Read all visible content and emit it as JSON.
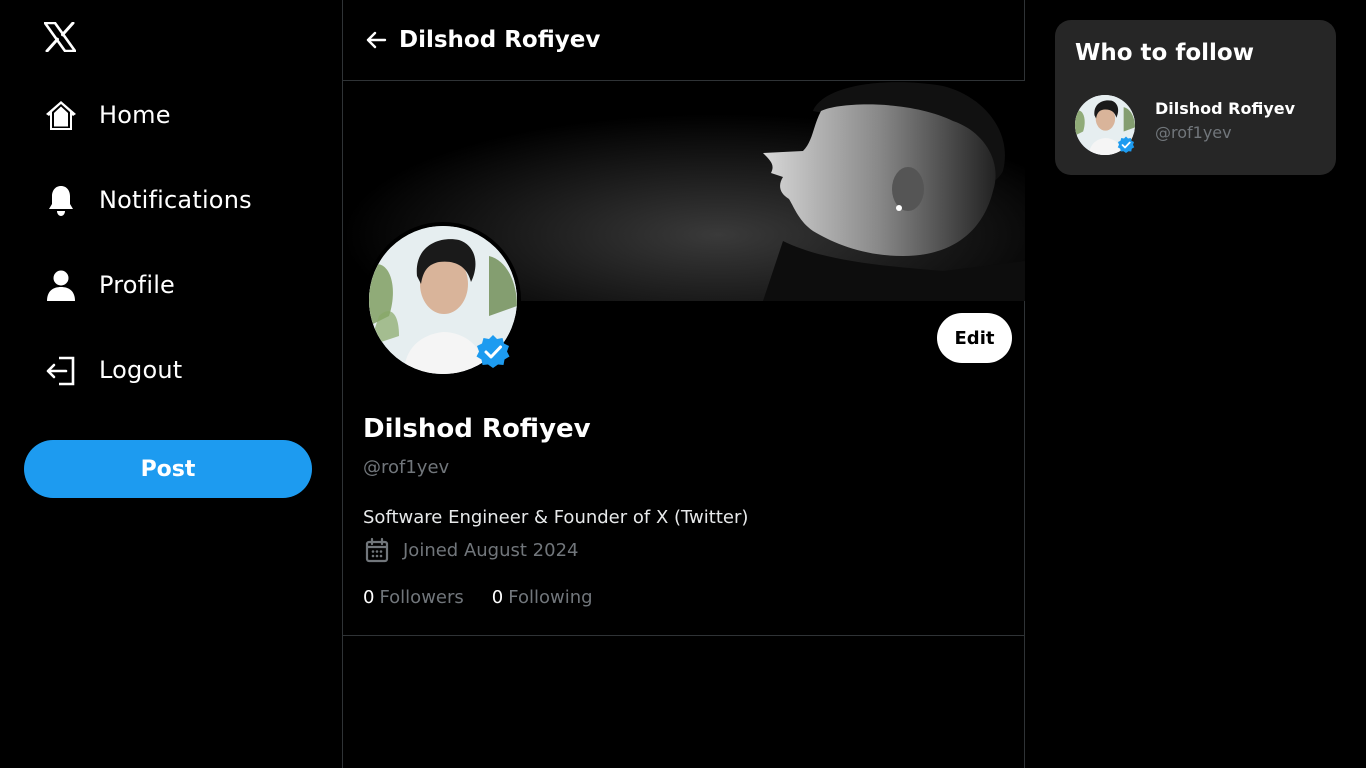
{
  "sidebar": {
    "logo": "x-logo",
    "items": [
      {
        "label": "Home",
        "icon": "home-icon"
      },
      {
        "label": "Notifications",
        "icon": "bell-icon"
      },
      {
        "label": "Profile",
        "icon": "user-icon"
      },
      {
        "label": "Logout",
        "icon": "logout-icon"
      }
    ],
    "post_label": "Post"
  },
  "header": {
    "title": "Dilshod Rofiyev",
    "back_icon": "arrow-left-icon"
  },
  "profile": {
    "name": "Dilshod Rofiyev",
    "handle": "@rof1yev",
    "bio": "Software Engineer & Founder of X (Twitter)",
    "joined": "Joined August 2024",
    "edit_label": "Edit",
    "followers_count": "0",
    "followers_label": "Followers",
    "following_count": "0",
    "following_label": "Following"
  },
  "who_to_follow": {
    "title": "Who to follow",
    "users": [
      {
        "name": "Dilshod Rofiyev",
        "handle": "@rof1yev"
      }
    ]
  },
  "colors": {
    "accent": "#1d9bf0",
    "background": "#000000",
    "card": "#262626",
    "muted_text": "#71767b",
    "border": "#2f3336"
  }
}
